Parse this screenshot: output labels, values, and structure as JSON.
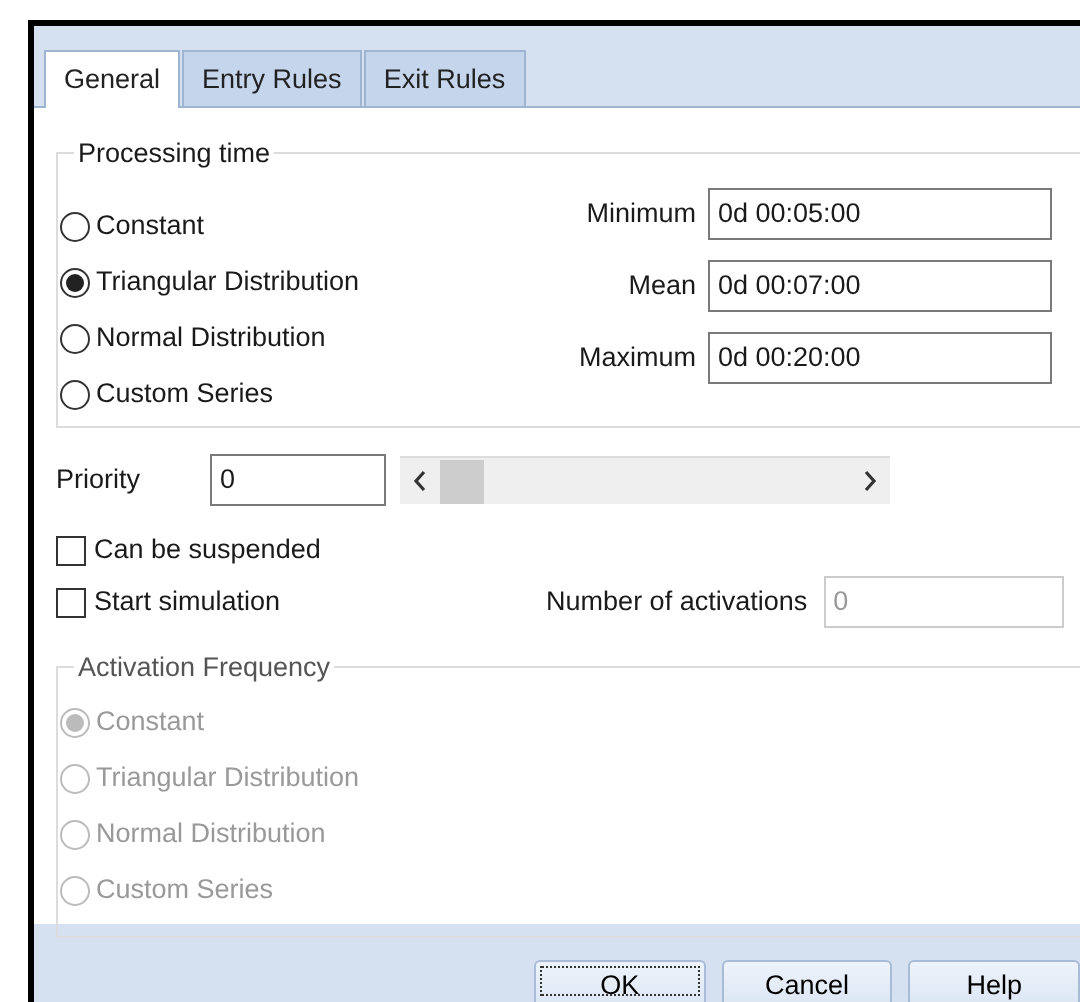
{
  "tabs": [
    {
      "label": "General",
      "selected": true
    },
    {
      "label": "Entry Rules",
      "selected": false
    },
    {
      "label": "Exit Rules",
      "selected": false
    }
  ],
  "processing_time": {
    "title": "Processing time",
    "options": [
      {
        "label": "Constant",
        "selected": false
      },
      {
        "label": "Triangular Distribution",
        "selected": true
      },
      {
        "label": "Normal Distribution",
        "selected": false
      },
      {
        "label": "Custom Series",
        "selected": false
      }
    ],
    "fields": [
      {
        "label": "Minimum",
        "value": "0d 00:05:00"
      },
      {
        "label": "Mean",
        "value": "0d 00:07:00"
      },
      {
        "label": "Maximum",
        "value": "0d 00:20:00"
      }
    ]
  },
  "priority": {
    "label": "Priority",
    "value": "0"
  },
  "checkboxes": [
    {
      "label": "Can be suspended",
      "checked": false
    },
    {
      "label": "Start simulation",
      "checked": false
    }
  ],
  "activations": {
    "label": "Number of activations",
    "value": "0",
    "disabled": true
  },
  "activation_frequency": {
    "title": "Activation Frequency",
    "disabled": true,
    "options": [
      {
        "label": "Constant",
        "selected": true
      },
      {
        "label": "Triangular Distribution",
        "selected": false
      },
      {
        "label": "Normal Distribution",
        "selected": false
      },
      {
        "label": "Custom Series",
        "selected": false
      }
    ]
  },
  "buttons": [
    {
      "label": "OK",
      "focused": true
    },
    {
      "label": "Cancel",
      "focused": false
    },
    {
      "label": "Help",
      "focused": false
    }
  ]
}
